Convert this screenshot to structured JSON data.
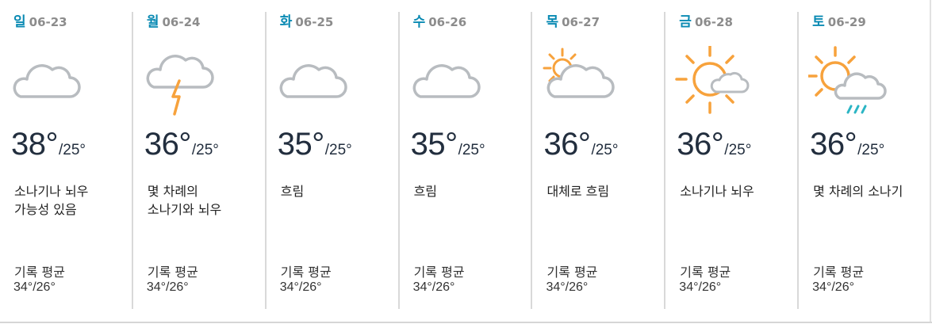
{
  "forecast": {
    "days": [
      {
        "weekday": "일",
        "date": "06-23",
        "high": "38°",
        "low": "/25°",
        "condition": "소나기나 뇌우 가능성 있음",
        "icon": "cloud-icon",
        "record_label": "기록 평균",
        "record_value": "34°/26°"
      },
      {
        "weekday": "월",
        "date": "06-24",
        "high": "36°",
        "low": "/25°",
        "condition": "몇 차례의 소나기와 뇌우",
        "icon": "thunderstorm-icon",
        "record_label": "기록 평균",
        "record_value": "34°/26°"
      },
      {
        "weekday": "화",
        "date": "06-25",
        "high": "35°",
        "low": "/25°",
        "condition": "흐림",
        "icon": "cloud-icon",
        "record_label": "기록 평균",
        "record_value": "34°/26°"
      },
      {
        "weekday": "수",
        "date": "06-26",
        "high": "35°",
        "low": "/25°",
        "condition": "흐림",
        "icon": "cloud-icon",
        "record_label": "기록 평균",
        "record_value": "34°/26°"
      },
      {
        "weekday": "목",
        "date": "06-27",
        "high": "36°",
        "low": "/25°",
        "condition": "대체로 흐림",
        "icon": "mostly-cloudy-icon",
        "record_label": "기록 평균",
        "record_value": "34°/26°"
      },
      {
        "weekday": "금",
        "date": "06-28",
        "high": "36°",
        "low": "/25°",
        "condition": "소나기나 뇌우",
        "icon": "partly-sunny-icon",
        "record_label": "기록 평균",
        "record_value": "34°/26°"
      },
      {
        "weekday": "토",
        "date": "06-29",
        "high": "36°",
        "low": "/25°",
        "condition": "몇 차례의 소나기",
        "icon": "sun-showers-icon",
        "record_label": "기록 평균",
        "record_value": "34°/26°"
      }
    ]
  },
  "colors": {
    "weekday": "#0a8ab3",
    "date": "#8c8c8c",
    "temperature": "#222e3e",
    "cloud_stroke": "#b8bcc0",
    "sun": "#f7a23c",
    "rain": "#2bb5c4",
    "separator": "#d9d9d9"
  }
}
